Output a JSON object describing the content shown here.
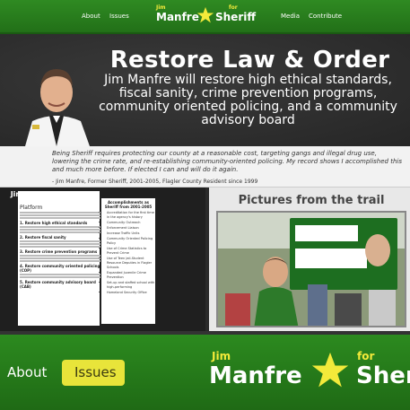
{
  "nav": {
    "about": "About",
    "issues": "Issues",
    "media": "Media",
    "contribute": "Contribute",
    "logo": {
      "jim": "Jim",
      "for": "for",
      "name": "Manfre",
      "office": "Sheriff"
    }
  },
  "hero": {
    "title": "Restore Law & Order",
    "text": "Jim Manfre will restore high ethical standards, fiscal sanity, crime prevention programs, community oriented policing, and a community advisory board"
  },
  "quote": {
    "text": "Being Sheriff requires protecting our county at a reasonable cost, targeting gangs and illegal drug use, lowering the crime rate, and re-establishing community-oriented policing. My record shows I accomplished this and much more before. If elected I can and will do it again.",
    "attribution": "- Jim Manfre, Former Sheriff, 2001-2005, Flagler County Resident since 1999"
  },
  "stance": {
    "title": "Jim's Stance on the Issues",
    "subtitle": "Platform",
    "sections": [
      "1. Restore high ethical standards",
      "2. Restore fiscal sanity",
      "3. Restore crime prevention programs",
      "4. Restore community oriented policing (COP)",
      "5. Restore community advisory board (CAB)"
    ],
    "accomplishments_title": "Accomplishments as Sheriff from 2001-2005",
    "accomplishments": [
      "Accreditation for the first time in the agency's history",
      "Community Outreach",
      "Enforcement Liaison",
      "Increase Traffic Units",
      "Community Oriented Policing Policy",
      "Use of Crime Statistics to Prevent Crime",
      "Use of Teen Jail-Student Resource Deputies in Flagler Schools",
      "Expanded Juvenile Crime Prevention",
      "Set-up and staffed school with high-performing",
      "Homeland Security Office"
    ]
  },
  "pictures": {
    "title": "Pictures from the trail"
  },
  "colors": {
    "brand_green": "#2c8a1f",
    "accent_yellow": "#f3ea3a",
    "dark_bg": "#262626"
  }
}
